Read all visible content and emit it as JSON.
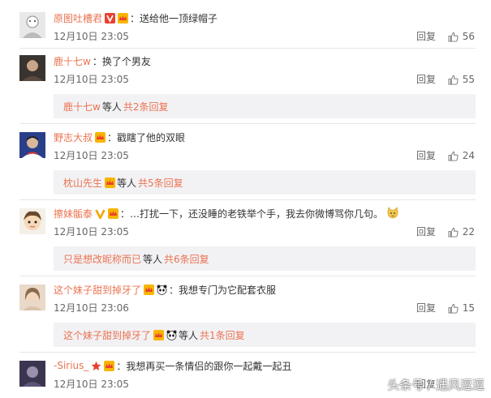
{
  "comments": [
    {
      "username": "原图吐槽君",
      "text": "送给他一顶绿帽子",
      "time": "12月10日 23:05",
      "reply_label": "回复",
      "likes": "56",
      "badges": [
        "vip-v-icon",
        "member-crown-icon"
      ]
    },
    {
      "username": "鹿十七w",
      "text": "换了个男友",
      "time": "12月10日 23:05",
      "reply_label": "回复",
      "likes": "55",
      "sub": {
        "name": "鹿十七w",
        "middle": "等人",
        "count": "共2条回复"
      }
    },
    {
      "username": "野志大叔",
      "text": "戳瞎了他的双眼",
      "time": "12月10日 23:05",
      "reply_label": "回复",
      "likes": "24",
      "badges": [
        "member-crown-icon"
      ],
      "sub": {
        "name": "枕山先生",
        "middle": "等人",
        "count": "共5条回复"
      }
    },
    {
      "username": "擦妹骺泰",
      "text": "…打扰一下，还没睡的老铁举个手，我去你微博骂你几句。",
      "time": "12月10日 23:05",
      "reply_label": "回复",
      "likes": "22",
      "badges": [
        "yellow-v-icon",
        "member-crown-icon"
      ],
      "sub": {
        "name": "只是想改昵称而已",
        "middle": "等人",
        "count": "共6条回复"
      }
    },
    {
      "username": "这个妹子甜到掉牙了",
      "text": "我想专门为它配套衣服",
      "time": "12月10日 23:06",
      "reply_label": "回复",
      "likes": "15",
      "badges": [
        "member-crown-icon",
        "panda-icon"
      ],
      "sub": {
        "name": "这个妹子甜到掉牙了",
        "middle": "等人",
        "count": "共1条回复"
      }
    },
    {
      "username": "-Sirius_",
      "text": "我想再买一条情侣的跟你一起戴一起丑",
      "time": "12月10日 23:05",
      "reply_label": "回复",
      "badges": [
        "red-star-icon",
        "member-crown-icon"
      ]
    }
  ],
  "watermark": "头条号 / 遇风逗逗",
  "colors": {
    "username": "#eb7350",
    "subbox_bg": "#f2f2f5",
    "text": "#333333",
    "meta": "#666666"
  }
}
